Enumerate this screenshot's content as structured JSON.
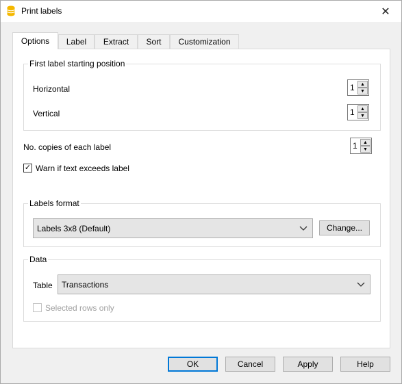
{
  "window": {
    "title": "Print labels",
    "close_glyph": "✕"
  },
  "tabs": [
    {
      "label": "Options"
    },
    {
      "label": "Label"
    },
    {
      "label": "Extract"
    },
    {
      "label": "Sort"
    },
    {
      "label": "Customization"
    }
  ],
  "first_label": {
    "title": "First label starting position",
    "horizontal_label": "Horizontal",
    "horizontal_value": "1",
    "vertical_label": "Vertical",
    "vertical_value": "1"
  },
  "copies": {
    "label": "No. copies of each label",
    "value": "1"
  },
  "warn": {
    "label": "Warn if text exceeds label",
    "checked": true,
    "check_glyph": "✓"
  },
  "labels_format": {
    "title": "Labels format",
    "selected": "Labels 3x8 (Default)",
    "change_label": "Change..."
  },
  "data": {
    "title": "Data",
    "table_label": "Table",
    "table_selected": "Transactions",
    "selected_rows_label": "Selected rows only",
    "selected_rows_checked": false
  },
  "buttons": {
    "ok": "OK",
    "cancel": "Cancel",
    "apply": "Apply",
    "help": "Help"
  },
  "icons": {
    "app": "database-icon",
    "close": "close-icon",
    "spin_up": "▲",
    "spin_down": "▼"
  },
  "colors": {
    "accent": "#0078d7",
    "app_icon": "#f5b800"
  }
}
